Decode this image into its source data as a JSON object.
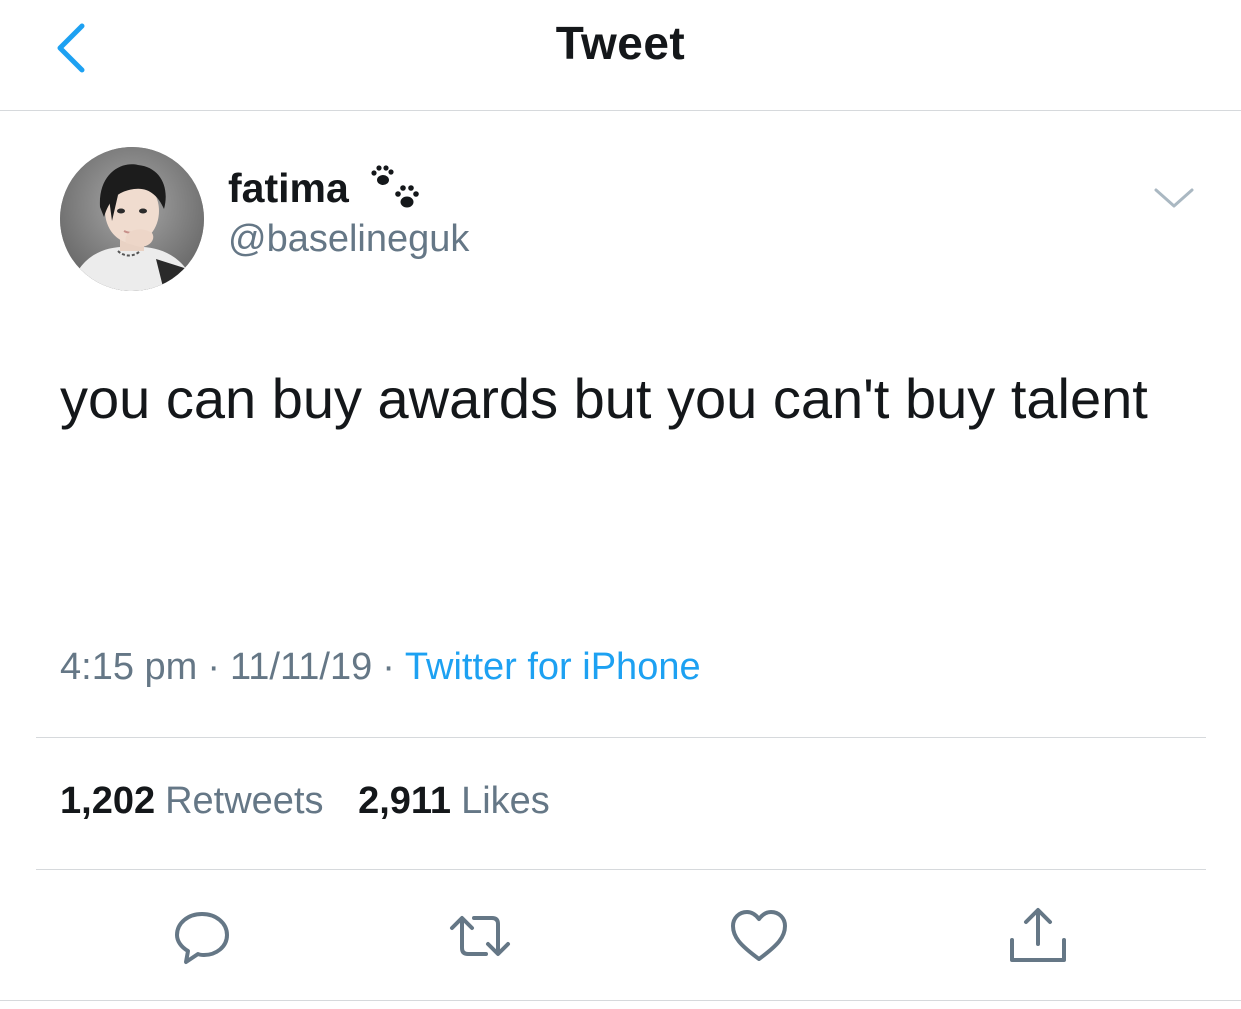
{
  "nav": {
    "title": "Tweet",
    "back_icon": "chevron-left-icon",
    "accent_color": "#1da1f2"
  },
  "author": {
    "display_name": "fatima",
    "name_emoji": "paw-prints-icon",
    "handle": "@baselineguk",
    "menu_icon": "chevron-down-icon"
  },
  "tweet": {
    "text": "you can buy awards but you can't buy talent"
  },
  "meta": {
    "time": "4:15 pm",
    "date": "11/11/19",
    "separator": "·",
    "source": "Twitter for iPhone"
  },
  "stats": {
    "retweets_count": "1,202",
    "retweets_label": "Retweets",
    "likes_count": "2,911",
    "likes_label": "Likes"
  },
  "actions": [
    {
      "name": "reply",
      "icon": "reply-icon"
    },
    {
      "name": "retweet",
      "icon": "retweet-icon"
    },
    {
      "name": "like",
      "icon": "heart-icon"
    },
    {
      "name": "share",
      "icon": "share-icon"
    }
  ],
  "colors": {
    "text_primary": "#14171a",
    "text_secondary": "#657786",
    "icon_gray": "#657786",
    "divider": "#d6d9dc"
  }
}
